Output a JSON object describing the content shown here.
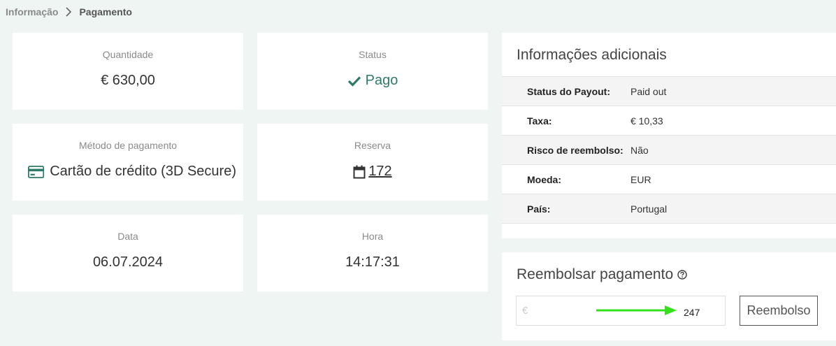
{
  "breadcrumb": {
    "parent": "Informação",
    "current": "Pagamento"
  },
  "cards": {
    "amount": {
      "label": "Quantidade",
      "value": "€ 630,00"
    },
    "status": {
      "label": "Status",
      "value": "Pago"
    },
    "method": {
      "label": "Método de pagamento",
      "value": "Cartão de crédito (3D Secure)"
    },
    "reservation": {
      "label": "Reserva",
      "value": "172"
    },
    "date": {
      "label": "Data",
      "value": "06.07.2024"
    },
    "time": {
      "label": "Hora",
      "value": "14:17:31"
    }
  },
  "additional": {
    "title": "Informações adicionais",
    "rows": [
      {
        "key": "Status do Payout:",
        "value": "Paid out"
      },
      {
        "key": "Taxa:",
        "value": "€ 10,33"
      },
      {
        "key": "Risco de reembolso:",
        "value": "Não"
      },
      {
        "key": "Moeda:",
        "value": "EUR"
      },
      {
        "key": "País:",
        "value": "Portugal"
      }
    ]
  },
  "refund": {
    "title": "Reembolsar pagamento",
    "currency_symbol": "€",
    "amount_value": "247",
    "button_label": "Reembolso"
  },
  "colors": {
    "accent": "#2f7a68",
    "background": "#eff5f3",
    "arrow": "#33e21a"
  }
}
